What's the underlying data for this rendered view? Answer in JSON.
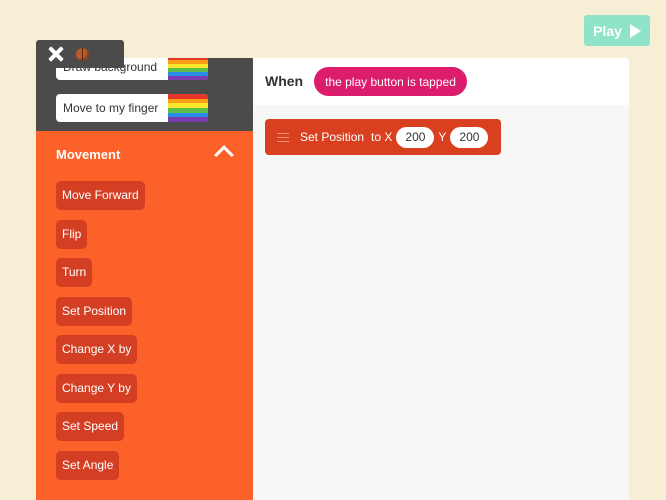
{
  "toolbar": {
    "play_label": "Play"
  },
  "rules": [
    {
      "label": "Draw background"
    },
    {
      "label": "Move to my finger"
    }
  ],
  "rule_stripe_colors": [
    "#e8352c",
    "#f9a01b",
    "#fce82a",
    "#5bbd4a",
    "#2a8be8",
    "#7a3bb0"
  ],
  "palette": {
    "category": "Movement",
    "blocks": [
      "Move Forward",
      "Flip",
      "Turn",
      "Set Position",
      "Change X by",
      "Change Y by",
      "Set Speed",
      "Set Angle"
    ]
  },
  "script": {
    "when_label": "When",
    "trigger": "the play button is tapped",
    "block": {
      "name": "Set Position",
      "to_x_label": "to X",
      "x": "200",
      "y_label": "Y",
      "y": "200"
    }
  },
  "colors": {
    "background": "#f6efd6",
    "palette_orange": "#fb6128",
    "block_red": "#d8401f",
    "trigger_pink": "#dc1c6c",
    "play_green": "#8ee3c8",
    "dark_panel": "#4b4b4b"
  }
}
